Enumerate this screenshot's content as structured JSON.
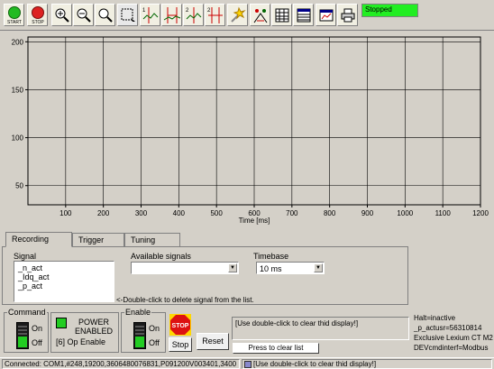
{
  "toolbar": {
    "start_label": "START",
    "stop_label": "STOP",
    "status": "Stopped",
    "tool_icons": [
      "zoom-in-icon",
      "zoom-out-icon",
      "zoom-fit-icon",
      "select-region-icon",
      "cursor1-icon",
      "cursor-distance-icon",
      "cursor2-icon",
      "measure-icon",
      "reset-cursor-icon",
      "grid-icon",
      "table-icon",
      "chart-settings-icon",
      "print-icon"
    ]
  },
  "chart_data": {
    "type": "line",
    "title": "",
    "xlabel": "Time [ms]",
    "ylabel": "",
    "xlim": [
      0,
      1200
    ],
    "ylim": [
      30,
      205
    ],
    "xticks": [
      100,
      200,
      300,
      400,
      500,
      600,
      700,
      800,
      900,
      1000,
      1100,
      1200
    ],
    "yticks": [
      50,
      100,
      150,
      200
    ],
    "grid": true,
    "series": []
  },
  "tabs": [
    {
      "label": "Recording",
      "active": true
    },
    {
      "label": "Trigger",
      "active": false
    },
    {
      "label": "Tuning",
      "active": false
    }
  ],
  "recording": {
    "signal_label": "Signal",
    "signals": [
      "_n_act",
      "_Idq_act",
      "_p_act"
    ],
    "available_label": "Available signals",
    "available_value": "",
    "timebase_label": "Timebase",
    "timebase_value": "10 ms",
    "hint": "<-Double-click to delete signal from the list."
  },
  "command": {
    "title": "Command",
    "on_label": "On",
    "off_label": "Off",
    "power_text": "POWER ENABLED",
    "op_state": "[6] Op Enable"
  },
  "enable": {
    "title": "Enable",
    "on_label": "On",
    "off_label": "Off",
    "stop_sign": "STOP",
    "stop_button": "Stop",
    "reset_button": "Reset"
  },
  "messages": {
    "display_text": "[Use double-click to clear thid display!]",
    "clear_button": "Press to clear list"
  },
  "info": {
    "halt": "Halt=inactive",
    "p_actusr": "_p_actusr=56310814",
    "device": "Exclusive Lexium CT M2",
    "interface": "DEVcmdinterf=Modbus"
  },
  "statusbar": {
    "connection": "Connected: COM1,#248,19200,3606480076831,P091200V003401,3400",
    "message": "[Use double-click to clear thid display!]"
  }
}
